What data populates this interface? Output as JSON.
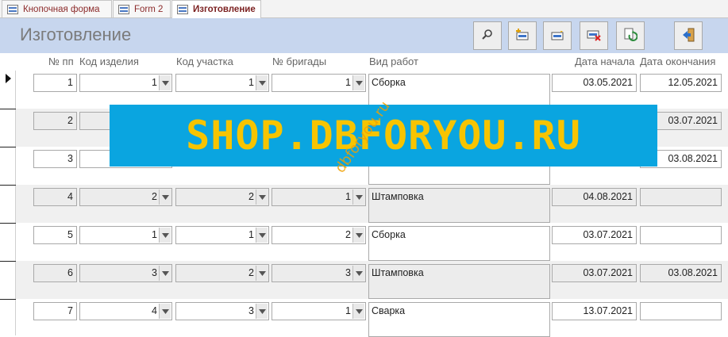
{
  "tabs": [
    {
      "label": "Кнопочная форма"
    },
    {
      "label": "Form 2"
    },
    {
      "label": "Изготовление"
    }
  ],
  "form": {
    "title": "Изготовление"
  },
  "columns": {
    "num": "№ пп",
    "product": "Код изделия",
    "section": "Код участка",
    "brigade": "№ бригады",
    "work": "Вид работ",
    "start": "Дата начала",
    "end": "Дата окончания"
  },
  "rows": [
    {
      "num": "1",
      "product": "1",
      "section": "1",
      "brigade": "1",
      "work": "Сборка",
      "start": "03.05.2021",
      "end": "12.05.2021"
    },
    {
      "num": "2",
      "product": "",
      "section": "",
      "brigade": "",
      "work": "",
      "start": "",
      "end": "03.07.2021"
    },
    {
      "num": "3",
      "product": "",
      "section": "",
      "brigade": "",
      "work": "",
      "start": "",
      "end": "03.08.2021"
    },
    {
      "num": "4",
      "product": "2",
      "section": "2",
      "brigade": "1",
      "work": "Штамповка",
      "start": "04.08.2021",
      "end": ""
    },
    {
      "num": "5",
      "product": "1",
      "section": "1",
      "brigade": "2",
      "work": "Сборка",
      "start": "03.07.2021",
      "end": ""
    },
    {
      "num": "6",
      "product": "3",
      "section": "2",
      "brigade": "3",
      "work": "Штамповка",
      "start": "03.07.2021",
      "end": "03.08.2021"
    },
    {
      "num": "7",
      "product": "4",
      "section": "3",
      "brigade": "1",
      "work": "Сварка",
      "start": "13.07.2021",
      "end": ""
    }
  ],
  "watermark": {
    "main": "SHOP.DBFORYOU.RU",
    "small": "dbforyou.ru"
  },
  "colors": {
    "header": "#c7d6ee",
    "accent": "#8b2a2a",
    "watermark_bg": "#0aa5e0",
    "watermark_fg": "#f7c400"
  },
  "toolbar_icons": [
    "search-icon",
    "new-record-icon",
    "add-record-icon",
    "delete-record-icon",
    "refresh-icon",
    "exit-icon"
  ]
}
